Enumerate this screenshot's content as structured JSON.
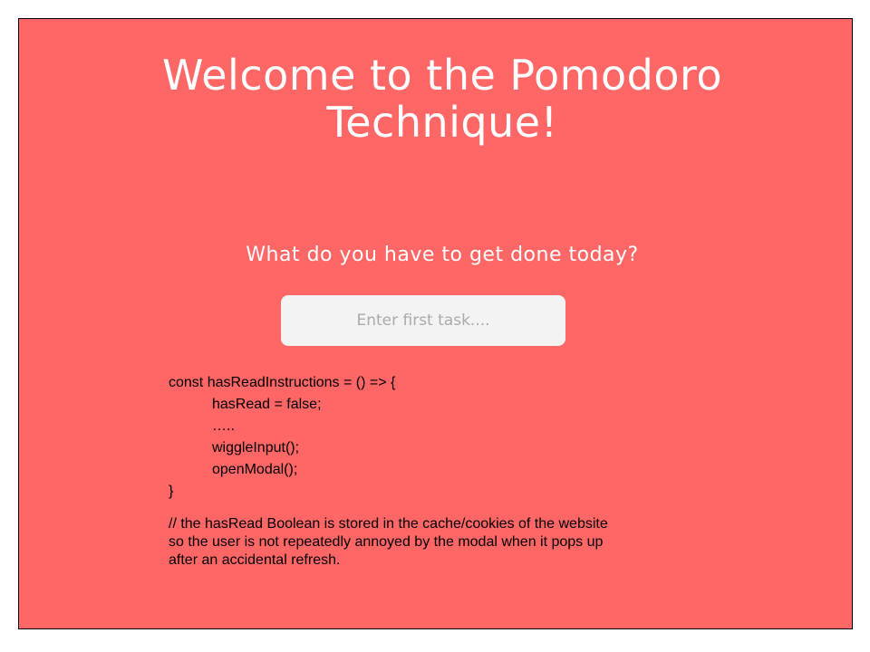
{
  "page": {
    "title_line1": "Welcome to the Pomodoro",
    "title_line2": "Technique!",
    "subtitle": "What do you have to get done today?",
    "task_input": {
      "placeholder": "Enter first task....",
      "value": ""
    },
    "background_color": "#ff6666"
  },
  "annotation": {
    "code_lines": [
      "const hasReadInstructions = () => {",
      "hasRead = false;",
      "…..",
      "wiggleInput();",
      "openModal();",
      "}"
    ],
    "note_lines": [
      "// the hasRead Boolean is stored in the cache/cookies of the website",
      "so the user is not repeatedly annoyed by the modal when it pops up",
      "after an accidental refresh."
    ]
  }
}
